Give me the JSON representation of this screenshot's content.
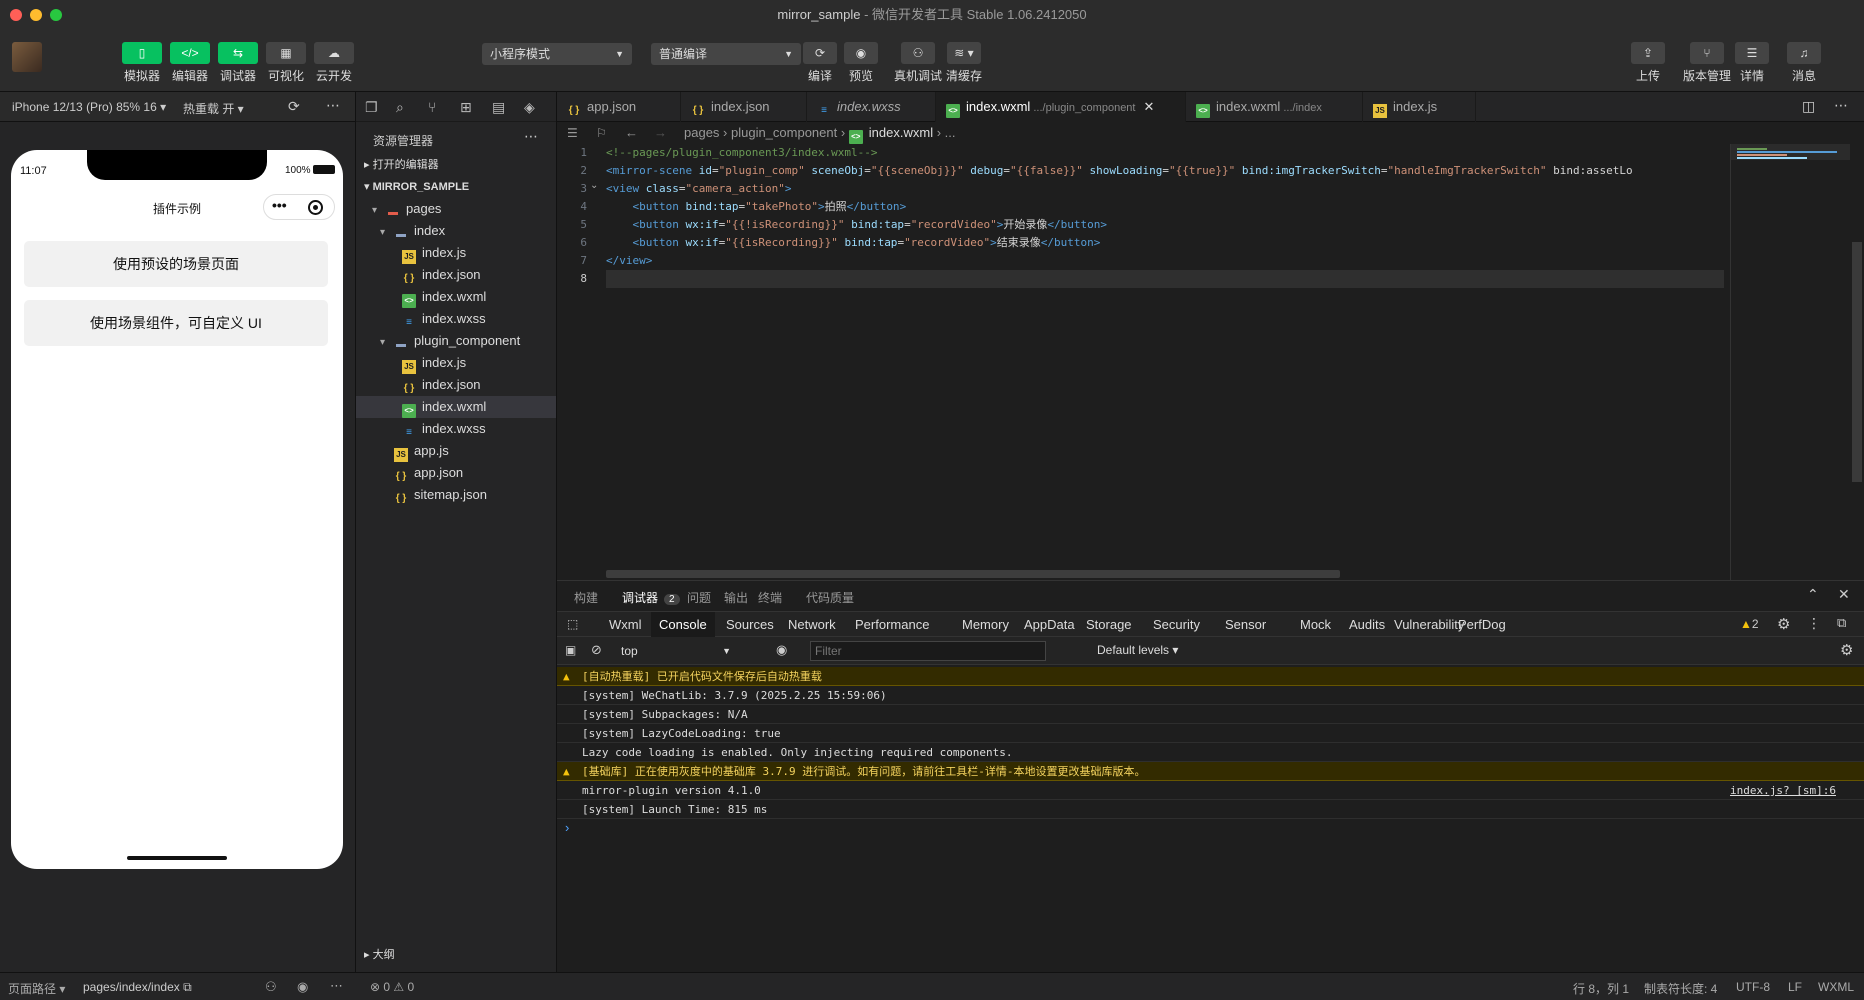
{
  "window": {
    "title": "mirror_sample",
    "subtitle": "微信开发者工具 Stable 1.06.2412050"
  },
  "toolbar": {
    "left_buttons": [
      {
        "label": "模拟器",
        "icon": "phone-icon"
      },
      {
        "label": "编辑器",
        "icon": "code-icon"
      },
      {
        "label": "调试器",
        "icon": "debug-icon"
      },
      {
        "label": "可视化",
        "icon": "layout-icon"
      },
      {
        "label": "云开发",
        "icon": "cloud-icon"
      }
    ],
    "mode_select": "小程序模式",
    "compile_select": "普通编译",
    "mid_buttons": [
      {
        "label": "编译",
        "icon": "refresh-icon"
      },
      {
        "label": "预览",
        "icon": "eye-icon"
      },
      {
        "label": "真机调试",
        "icon": "bug-icon"
      },
      {
        "label": "清缓存",
        "icon": "layers-icon"
      }
    ],
    "right_buttons": [
      {
        "label": "上传",
        "icon": "upload-icon"
      },
      {
        "label": "版本管理",
        "icon": "branch-icon"
      },
      {
        "label": "详情",
        "icon": "menu-icon"
      },
      {
        "label": "消息",
        "icon": "bell-icon"
      }
    ]
  },
  "simulator": {
    "device": "iPhone 12/13 (Pro) 85% 16",
    "hot_reload": "热重载 开",
    "time": "11:07",
    "battery": "100%",
    "page_title": "插件示例",
    "buttons": [
      "使用预设的场景页面",
      "使用场景组件，可自定义 UI"
    ]
  },
  "explorer": {
    "title": "资源管理器",
    "open_editors": "打开的编辑器",
    "project": "MIRROR_SAMPLE",
    "outline": "大纲",
    "tree": [
      {
        "name": "pages",
        "type": "pfolder",
        "depth": 1
      },
      {
        "name": "index",
        "type": "folder",
        "depth": 2
      },
      {
        "name": "index.js",
        "type": "js",
        "depth": 3
      },
      {
        "name": "index.json",
        "type": "json",
        "depth": 3
      },
      {
        "name": "index.wxml",
        "type": "wxml",
        "depth": 3
      },
      {
        "name": "index.wxss",
        "type": "wxss",
        "depth": 3
      },
      {
        "name": "plugin_component",
        "type": "folder",
        "depth": 2
      },
      {
        "name": "index.js",
        "type": "js",
        "depth": 3
      },
      {
        "name": "index.json",
        "type": "json",
        "depth": 3
      },
      {
        "name": "index.wxml",
        "type": "wxml",
        "depth": 3,
        "selected": true
      },
      {
        "name": "index.wxss",
        "type": "wxss",
        "depth": 3
      },
      {
        "name": "app.js",
        "type": "js",
        "depth": 2
      },
      {
        "name": "app.json",
        "type": "json",
        "depth": 2
      },
      {
        "name": "sitemap.json",
        "type": "json",
        "depth": 2
      }
    ]
  },
  "tabs": [
    {
      "name": "app.json",
      "type": "json"
    },
    {
      "name": "index.json",
      "type": "json"
    },
    {
      "name": "index.wxss",
      "type": "wxss"
    },
    {
      "name": "index.wxml",
      "type": "wxml",
      "hint": ".../plugin_component",
      "active": true
    },
    {
      "name": "index.wxml",
      "type": "wxml",
      "hint": ".../index"
    },
    {
      "name": "index.js",
      "type": "js"
    }
  ],
  "breadcrumb": [
    "pages",
    "plugin_component",
    "index.wxml",
    "..."
  ],
  "code_lines": [
    "<!--pages/plugin_component3/index.wxml-->",
    "<mirror-scene id=\"plugin_comp\" sceneObj=\"{{sceneObj}}\" debug=\"{{false}}\" showLoading=\"{{true}}\" bind:imgTrackerSwitch=\"handleImgTrackerSwitch\" bind:assetLo",
    "<view class=\"camera_action\">",
    "    <button bind:tap=\"takePhoto\">拍照</button>",
    "    <button wx:if=\"{{!isRecording}}\" bind:tap=\"recordVideo\">开始录像</button>",
    "    <button wx:if=\"{{isRecording}}\" bind:tap=\"recordVideo\">结束录像</button>",
    "</view>",
    ""
  ],
  "panel": {
    "tabs": [
      "构建",
      "调试器",
      "问题",
      "输出",
      "终端",
      "代码质量"
    ],
    "debugger_badge": "2",
    "devtools_tabs": [
      "Wxml",
      "Console",
      "Sources",
      "Network",
      "Performance",
      "Memory",
      "AppData",
      "Storage",
      "Security",
      "Sensor",
      "Mock",
      "Audits",
      "Vulnerability",
      "PerfDog"
    ],
    "warn_count": "2",
    "context": "top",
    "filter_placeholder": "Filter",
    "levels": "Default levels",
    "console": [
      {
        "text": "[自动热重载] 已开启代码文件保存后自动热重载",
        "level": "warn"
      },
      {
        "text": "[system] WeChatLib: 3.7.9 (2025.2.25 15:59:06)",
        "level": "info"
      },
      {
        "text": "[system] Subpackages: N/A",
        "level": "info"
      },
      {
        "text": "[system] LazyCodeLoading: true",
        "level": "info"
      },
      {
        "text": "Lazy code loading is enabled. Only injecting required components.",
        "level": "info"
      },
      {
        "text": "[基础库] 正在使用灰度中的基础库 3.7.9 进行调试。如有问题，请前往工具栏-详情-本地设置更改基础库版本。",
        "level": "warn"
      },
      {
        "text": "mirror-plugin version 4.1.0",
        "level": "info",
        "source": "index.js? [sm]:6"
      },
      {
        "text": "[system] Launch Time: 815 ms",
        "level": "info"
      }
    ],
    "prompt": "›"
  },
  "status": {
    "page_path_label": "页面路径",
    "page_path": "pages/index/index",
    "problems": "⊗ 0 ⚠ 0",
    "cursor": "行 8，列 1",
    "tab_size": "制表符长度: 4",
    "encoding": "UTF-8",
    "eol": "LF",
    "language": "WXML"
  },
  "colors": {
    "accent": "#07c160",
    "warn_bg": "#332b00",
    "editor_bg": "#1e1e1e"
  }
}
